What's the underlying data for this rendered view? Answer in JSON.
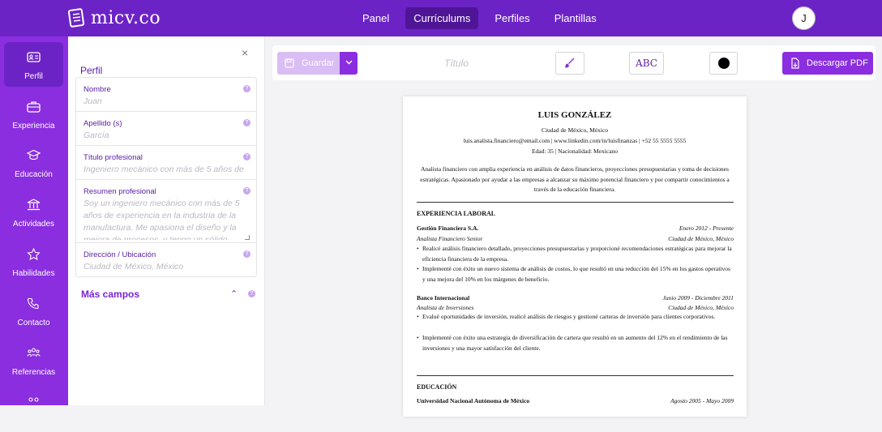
{
  "brand": {
    "logo_text": "micv.co"
  },
  "nav": {
    "items": [
      "Panel",
      "Currículums",
      "Perfiles",
      "Plantillas"
    ],
    "active": "Currículums"
  },
  "user": {
    "initial": "J"
  },
  "rail": {
    "items": [
      {
        "label": "Perfil",
        "icon": "id-card-icon"
      },
      {
        "label": "Experiencia",
        "icon": "briefcase-icon"
      },
      {
        "label": "Educación",
        "icon": "graduation-cap-icon"
      },
      {
        "label": "Actividades",
        "icon": "building-icon"
      },
      {
        "label": "Habilidades",
        "icon": "star-icon"
      },
      {
        "label": "Contacto",
        "icon": "phone-icon"
      },
      {
        "label": "Referencias",
        "icon": "people-icon"
      }
    ]
  },
  "profile": {
    "title": "Perfil",
    "close": "×",
    "help": "?",
    "fields": [
      {
        "label": "Nombre",
        "placeholder": "Juan"
      },
      {
        "label": "Apellido (s)",
        "placeholder": "García"
      },
      {
        "label": "Título profesional",
        "placeholder": "Ingeniero mecánico con más de 5 años de"
      },
      {
        "label": "Resumen profesional",
        "placeholder": "Soy un ingeniero mecánico con más de 5 años de experiencia en la industria de la manufactura. Me apasiona el diseño y la mejora de procesos, y tengo un sólido"
      },
      {
        "label": "Dirección / Ubicación",
        "placeholder": "Ciudad de México, México"
      }
    ],
    "more_fields": "Más campos",
    "more_chevron": "⌃"
  },
  "toolbar": {
    "save_label": "Guardar",
    "title_placeholder": "Título",
    "font_label": "ABC",
    "download_label": "Descargar PDF",
    "text_color": "#000000"
  },
  "resume": {
    "name": "LUIS GONZÁLEZ",
    "location": "Ciudad de México, México",
    "contact": "luis.analista.financiero@email.com | www.linkedin.com/in/luisfinanzas | +52 55 5555 5555",
    "personal": "Edad: 35 | Nacionalidad: Mexicano",
    "summary": "Analista financiero con amplia experiencia en análisis de datos financieros, proyecciones presupuestarias y toma de decisiones estratégicas. Apasionado por ayudar a las empresas a alcanzar su máximo potencial financiero y por compartir conocimientos a través de la educación financiera.",
    "experience_title": "EXPERIENCIA LABORAL",
    "jobs": [
      {
        "company": "Gestión Financiera S.A.",
        "dates": "Enero 2012 - Presente",
        "role": "Analista Financiero Senior",
        "city": "Ciudad de México, México",
        "bullets": [
          "Realicé análisis financiero detallado, proyecciones presupuestarias y proporcioné recomendaciones estratégicas para mejorar la eficiencia financiera de la empresa.",
          "Implementé con éxito un nuevo sistema de análisis de costos, lo que resultó en una reducción del 15% en los gastos operativos y una mejora del 10% en los márgenes de beneficio."
        ]
      },
      {
        "company": "Banco Internacional",
        "dates": "Junio 2009 - Diciembre 2011",
        "role": "Analista de Inversiones",
        "city": "Ciudad de México, México",
        "bullets": [
          "Evalué oportunidades de inversión, realicé análisis de riesgos y gestioné carteras de inversión para clientes corporativos.",
          "Implementé con éxito una estrategia de diversificación de cartera que resultó en un aumento del 12% en el rendimiento de las inversiones y una mayor satisfacción del cliente."
        ]
      }
    ],
    "education_title": "EDUCACIÓN",
    "school": "Universidad Nacional Autónoma de México",
    "school_dates": "Agosto 2005 - Mayo 2009"
  }
}
